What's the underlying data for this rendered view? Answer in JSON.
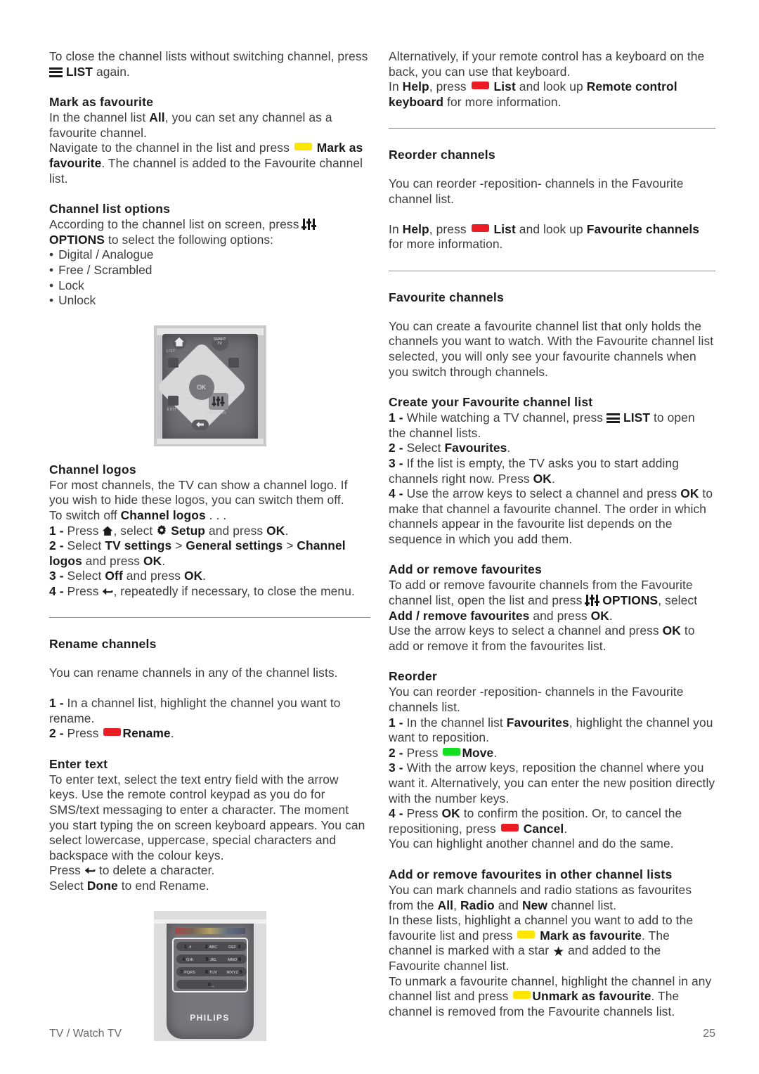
{
  "footer": {
    "breadcrumb": "TV / Watch TV",
    "page_number": "25"
  },
  "colors": {
    "yellow_key": "#ffe500",
    "red_key": "#ed1c24",
    "green_key": "#13e020"
  },
  "left": {
    "intro": {
      "part1": "To close the channel lists without switching channel, press ",
      "list_label": "LIST",
      "part2": " again."
    },
    "mark_as_favourite": {
      "heading": "Mark as favourite",
      "p1_a": "In the channel list ",
      "p1_all": "All",
      "p1_b": ", you can set any channel as a favourite channel.",
      "p2_a": "Navigate to the channel in the list and press ",
      "p2_bold": "Mark as favourite",
      "p2_b": ". The channel is added to the Favourite channel list."
    },
    "channel_list_options": {
      "heading": "Channel list options",
      "p1_a": "According to the channel list on screen, press ",
      "options_label": "OPTIONS",
      "p1_b": " to select the following options:",
      "items": [
        "Digital / Analogue",
        "Free / Scrambled",
        "Lock",
        "Unlock"
      ]
    },
    "remote_figure": {
      "home": "home-icon",
      "smart_tv": "SMART TV",
      "list": "LIST",
      "exit": "EXIT",
      "options": "OPTIONS",
      "ok": "OK"
    },
    "channel_logos": {
      "heading": "Channel logos",
      "p1": "For most channels, the TV can show a channel logo. If you wish to hide these logos, you can switch them off.",
      "p2_a": "To switch off ",
      "p2_bold": "Channel logos",
      "p2_b": " . . .",
      "step1_a": "Press ",
      "step1_b": ", select ",
      "step1_setup": "Setup",
      "step1_c": " and press ",
      "step1_ok": "OK",
      "step1_d": ".",
      "step2_a": "Select ",
      "step2_tv": "TV settings",
      "step2_gen": "General settings",
      "step2_logos": "Channel logos",
      "step2_b": " and press ",
      "step2_ok": "OK",
      "step2_c": ".",
      "step3_a": "Select ",
      "step3_off": "Off",
      "step3_b": " and press ",
      "step3_ok": "OK",
      "step3_c": ".",
      "step4_a": "Press ",
      "step4_b": ", repeatedly if necessary, to close the menu.",
      "n1": "1 -",
      "n2": "2 -",
      "n3": "3 -",
      "n4": "4 -"
    },
    "rename_channels": {
      "heading": "Rename channels",
      "p1": "You can rename channels in any of the channel lists.",
      "n1": "1 -",
      "step1": " In a channel list, highlight the channel you want to rename.",
      "n2": "2 -",
      "step2_a": " Press ",
      "step2_bold": "Rename",
      "step2_b": "."
    },
    "enter_text": {
      "heading": "Enter text",
      "p1": "To enter text, select the text entry field with the arrow keys. Use the remote control keypad as you do for SMS/text messaging to enter a character. The moment you start typing the on screen keyboard appears. You can select lowercase, uppercase, special characters and backspace with the colour keys.",
      "p2_a": "Press ",
      "p2_b": " to delete a character.",
      "p3_a": "Select ",
      "p3_done": "Done",
      "p3_b": " to end Rename."
    },
    "keypad_figure": {
      "brand": "PHILIPS",
      "rows": [
        [
          {
            "main": "1",
            "sub": ".#"
          },
          {
            "main": "2",
            "sub": "ABC"
          },
          {
            "main": "3",
            "sub": "DEF"
          }
        ],
        [
          {
            "main": "4",
            "sub": "GHI"
          },
          {
            "main": "5",
            "sub": "JKL"
          },
          {
            "main": "6",
            "sub": "MNO"
          }
        ],
        [
          {
            "main": "7",
            "sub": "PQRS"
          },
          {
            "main": "8",
            "sub": "TUV"
          },
          {
            "main": "9",
            "sub": "WXYZ"
          }
        ]
      ],
      "zero": "0",
      "zero_sub": "_"
    }
  },
  "right": {
    "keyboard_note": {
      "p1": "Alternatively, if your remote control has a keyboard on the back, you can use that keyboard.",
      "p2_a": "In ",
      "p2_help": "Help",
      "p2_b": ", press ",
      "p2_list": "List",
      "p2_c": " and look up ",
      "p2_topic": "Remote control keyboard",
      "p2_d": " for more information."
    },
    "reorder_channels": {
      "heading": "Reorder channels",
      "p1": "You can reorder -reposition- channels in the Favourite channel list.",
      "p2_a": "In ",
      "p2_help": "Help",
      "p2_b": ", press ",
      "p2_list": "List",
      "p2_c": " and look up ",
      "p2_topic": "Favourite channels",
      "p2_d": " for more information."
    },
    "favourite_channels": {
      "heading": "Favourite channels",
      "p1": "You can create a favourite channel list that only holds the channels you want to watch. With the Favourite channel list selected, you will only see your favourite channels when you switch through channels."
    },
    "create_list": {
      "heading": "Create your Favourite channel list",
      "n1": "1 -",
      "n2": "2 -",
      "n3": "3 -",
      "n4": "4 -",
      "step1_a": " While watching a TV channel, press ",
      "step1_list": "LIST",
      "step1_b": " to open the channel lists.",
      "step2_a": " Select ",
      "step2_bold": "Favourites",
      "step2_b": ".",
      "step3_a": " If the list is empty, the TV asks you to start adding channels right now. Press ",
      "step3_ok": "OK",
      "step3_b": ".",
      "step4_a": " Use the arrow keys to select a channel and press ",
      "step4_ok": "OK",
      "step4_b": " to make that channel a favourite channel. The order in which channels appear in the favourite list depends on the sequence in which you add them."
    },
    "add_remove": {
      "heading": "Add or remove favourites",
      "p1_a": "To add or remove favourite channels from the Favourite channel list, open the list and press ",
      "p1_options": "OPTIONS",
      "p1_b": ", select ",
      "p1_bold": "Add / remove favourites",
      "p1_c": " and press ",
      "p1_ok": "OK",
      "p1_d": ".",
      "p2_a": "Use the arrow keys to select a channel and press ",
      "p2_ok": "OK",
      "p2_b": " to add or remove it from the favourites list."
    },
    "reorder": {
      "heading": "Reorder",
      "p1": "You can reorder -reposition- channels in the Favourite channels list.",
      "n1": "1 -",
      "n2": "2 -",
      "n3": "3 -",
      "n4": "4 -",
      "step1_a": " In the channel list ",
      "step1_bold": "Favourites",
      "step1_b": ", highlight the channel you want to reposition.",
      "step2_a": " Press ",
      "step2_bold": "Move",
      "step2_b": ".",
      "step3": " With the arrow keys, reposition the channel where you want it. Alternatively, you can enter the new position directly with the number keys.",
      "step4_a": " Press ",
      "step4_ok": "OK",
      "step4_b": " to confirm the position. Or, to cancel the repositioning, press ",
      "step4_bold": "Cancel",
      "step4_c": ".",
      "p_last": "You can highlight another channel and do the same."
    },
    "other_lists": {
      "heading": "Add or remove favourites in other channel lists",
      "p1_a": "You can mark channels and radio stations as favourites from the ",
      "p1_all": "All",
      "p1_radio": "Radio",
      "p1_and": " and ",
      "p1_new": "New",
      "p1_b": " channel list.",
      "p2_a": "In these lists, highlight a channel you want to add to the favourite list and press ",
      "p2_bold": "Mark as favourite",
      "p2_b": ". The channel is marked with a star ",
      "p2_c": " and added to the Favourite channel list.",
      "p3_a": "To unmark a favourite channel, highlight the channel in any channel list and press ",
      "p3_bold": "Unmark as favourite",
      "p3_b": ". The channel is removed from the Favourite channels list."
    }
  }
}
